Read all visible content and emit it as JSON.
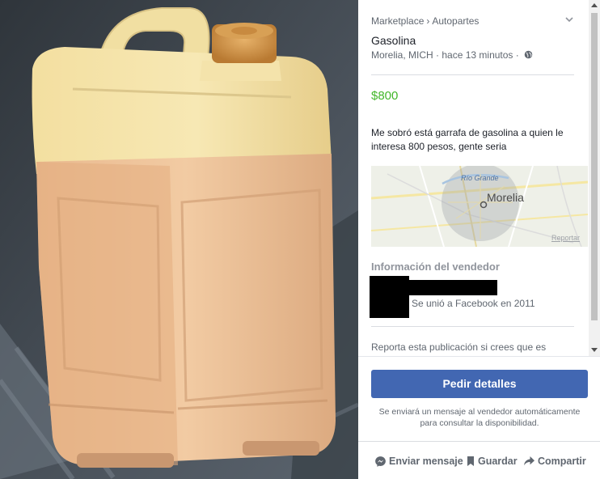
{
  "breadcrumb": {
    "category": "Marketplace",
    "subcategory": "Autopartes"
  },
  "listing": {
    "title": "Gasolina",
    "location": "Morelia, MICH",
    "time": "hace 13 minutos",
    "price": "$800",
    "description": "Me sobró está garrafa de gasolina a quien le interesa 800 pesos, gente seria"
  },
  "map": {
    "city_label": "Morelia",
    "river_label": "Río Grande",
    "report_link": "Reportar"
  },
  "seller": {
    "heading": "Información del vendedor",
    "joined": "Se unió a Facebook en 2011"
  },
  "report_prompt": "Reporta esta publicación si crees que es",
  "cta": {
    "button_label": "Pedir detalles",
    "note": "Se enviará un mensaje al vendedor automáticamente para consultar la disponibilidad."
  },
  "actions": {
    "message": "Enviar mensaje",
    "save": "Guardar",
    "share": "Compartir"
  },
  "colors": {
    "accent": "#4267b2",
    "price": "#42b72a",
    "muted_text": "#606770"
  }
}
